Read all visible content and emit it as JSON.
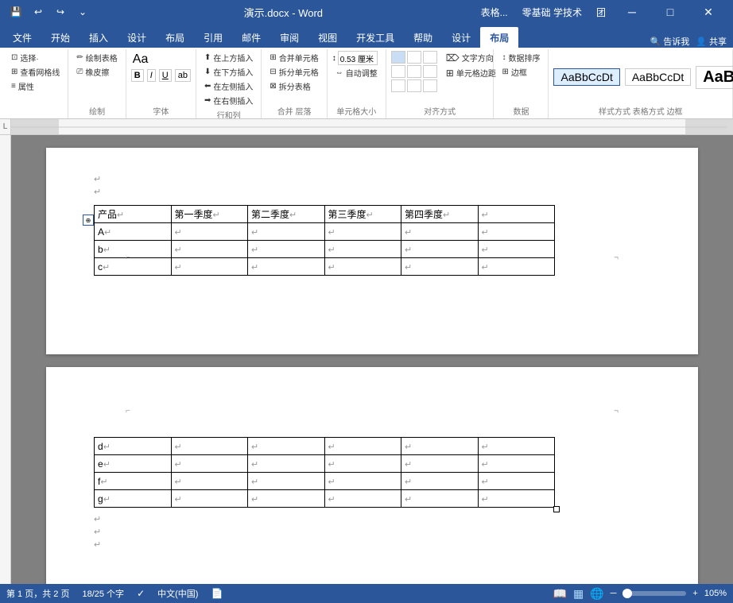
{
  "titlebar": {
    "title": "演示.docx - Word",
    "app_name": "Word",
    "minimize": "─",
    "maximize": "□",
    "close": "✕"
  },
  "tabbar": {
    "tabs": [
      {
        "label": "表格...",
        "active": false
      },
      {
        "label": "零基础 学技术",
        "active": false
      },
      {
        "label": "团",
        "active": false
      }
    ],
    "right_items": [
      "告诉我",
      "共享"
    ]
  },
  "ribbon": {
    "tab_items": [
      "文件",
      "开始",
      "插入",
      "设计",
      "布局",
      "引用",
      "邮件",
      "审阅",
      "视图",
      "开发工具",
      "帮助",
      "设计",
      "布局"
    ],
    "active_tab": "布局",
    "groups": {
      "select": {
        "label": "选择·",
        "items": [
          "查看网格线",
          "属性"
        ]
      },
      "draw": {
        "label": "绘制",
        "items": [
          "绘制表格",
          "橡皮擦"
        ]
      },
      "insert_rows_cols": {
        "label": "行和列",
        "items": [
          "在上方插入",
          "在下方插入",
          "在左侧插入",
          "在右侧插入"
        ]
      },
      "merge": {
        "label": "合并 层落",
        "items": [
          "合并单元格",
          "拆分单元格",
          "拆分表格"
        ]
      },
      "cell_size": {
        "label": "单元格大小",
        "items": [
          "0.53 厘米",
          "自动调整"
        ]
      },
      "alignment": {
        "label": "对齐方式",
        "items": []
      },
      "data": {
        "label": "数据",
        "items": [
          "数据排序",
          "边框"
        ]
      }
    }
  },
  "page1": {
    "table": {
      "headers": [
        "产品↵",
        "第一季度↵",
        "第二季度↵",
        "第三季度↵",
        "第四季度↵",
        "↵"
      ],
      "rows": [
        [
          "A↵",
          "↵",
          "↵",
          "↵",
          "↵",
          "↵"
        ],
        [
          "b↵",
          "↵",
          "↵",
          "↵",
          "↵",
          "↵"
        ],
        [
          "c↵",
          "↵",
          "↵",
          "↵",
          "↵",
          "↵"
        ]
      ]
    }
  },
  "page2": {
    "table": {
      "rows": [
        [
          "d↵",
          "↵",
          "↵",
          "↵",
          "↵",
          "↵"
        ],
        [
          "e↵",
          "↵",
          "↵",
          "↵",
          "↵",
          "↵"
        ],
        [
          "f↵",
          "↵",
          "↵",
          "↵",
          "↵",
          "↵"
        ],
        [
          "g↵",
          "↵",
          "↵",
          "↵",
          "↵",
          "↵"
        ]
      ]
    }
  },
  "statusbar": {
    "page_info": "第 1 页，共 2 页",
    "word_count": "18/25 个字",
    "lang": "中文(中国)",
    "zoom": "105%",
    "zoom_value": 105
  }
}
